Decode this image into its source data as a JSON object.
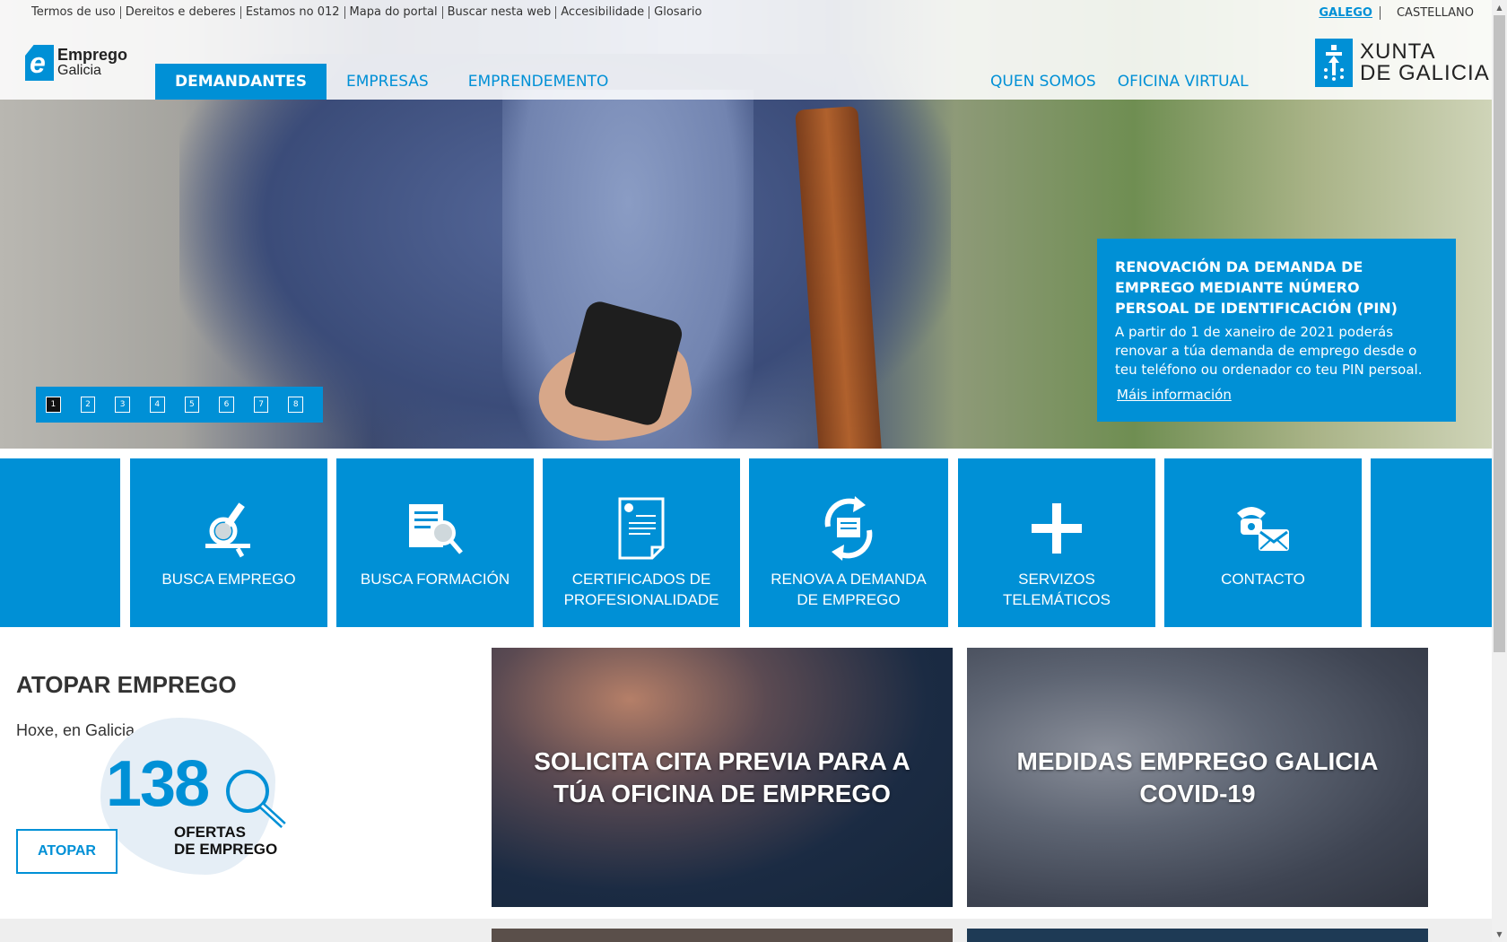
{
  "util_links": [
    "Termos de uso",
    "Dereitos e deberes",
    "Estamos no 012",
    "Mapa do portal",
    "Buscar nesta web",
    "Accesibilidade",
    "Glosario"
  ],
  "lang": {
    "galego": "GALEGO",
    "castellano": "CASTELLANO"
  },
  "logo": {
    "line1": "Emprego",
    "line2": "Galicia"
  },
  "nav": {
    "demandantes": "DEMANDANTES",
    "empresas": "EMPRESAS",
    "emprendemento": "EMPRENDEMENTO",
    "quen_somos": "QUEN SOMOS",
    "oficina_virtual": "OFICINA VIRTUAL"
  },
  "xunta": {
    "line1": "XUNTA",
    "line2": "DE GALICIA"
  },
  "pager": [
    "1",
    "2",
    "3",
    "4",
    "5",
    "6",
    "7",
    "8"
  ],
  "promo": {
    "title": "RENOVACIÓN DA DEMANDA DE EMPREGO MEDIANTE NÚMERO PERSOAL DE IDENTIFICACIÓN (PIN)",
    "text": "A partir do 1 de xaneiro de 2021 poderás renovar a túa demanda de emprego desde o teu teléfono ou ordenador co teu PIN persoal.",
    "more": "Máis información"
  },
  "tiles": {
    "busca_emprego": "BUSCA EMPREGO",
    "busca_formacion": "BUSCA FORMACIÓN",
    "certificados_1": "CERTIFICADOS DE",
    "certificados_2": "PROFESIONALIDADE",
    "renova_1": "RENOVA A DEMANDA",
    "renova_2": "DE EMPREGO",
    "servizos_1": "SERVIZOS",
    "servizos_2": "TELEMÁTICOS",
    "contacto": "CONTACTO"
  },
  "atopar": {
    "title": "ATOPAR EMPREGO",
    "subtitle": "Hoxe, en Galicia",
    "count": "138",
    "count_label_1": "OFERTAS",
    "count_label_2": "DE EMPREGO",
    "button": "ATOPAR"
  },
  "banners": {
    "cita_1": "SOLICITA CITA PREVIA PARA A",
    "cita_2": "TÚA OFICINA DE EMPREGO",
    "covid_1": "MEDIDAS EMPREGO GALICIA",
    "covid_2": "COVID-19"
  },
  "colors": {
    "brand": "#0090d6",
    "text": "#333333"
  }
}
